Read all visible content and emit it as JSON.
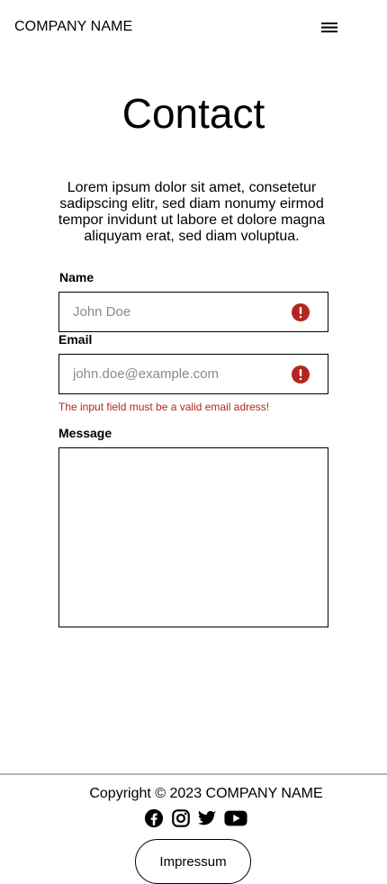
{
  "header": {
    "brand": "COMPANY NAME",
    "menu_icon": "hamburger-menu-icon"
  },
  "main": {
    "title": "Contact",
    "intro": "Lorem ipsum dolor sit amet, consetetur sadipscing elitr, sed diam nonumy eirmod tempor invidunt ut labore et dolore magna aliquyam erat, sed diam voluptua."
  },
  "form": {
    "name": {
      "label": "Name",
      "placeholder": "John Doe",
      "value": "",
      "status_icon": "error-icon"
    },
    "email": {
      "label": "Email",
      "placeholder": "john.doe@example.com",
      "value": "",
      "status_icon": "error-icon",
      "error": "The input field must be a valid email adress!"
    },
    "message": {
      "label": "Message",
      "value": ""
    }
  },
  "footer": {
    "copyright": "Copyright © 2023 COMPANY NAME",
    "socials": [
      "facebook-icon",
      "instagram-icon",
      "twitter-icon",
      "youtube-icon"
    ],
    "impressum_label": "Impressum"
  },
  "colors": {
    "error": "#b3261e",
    "text": "#000000",
    "placeholder": "#8a8a8a",
    "divider": "#b5b5b5"
  }
}
